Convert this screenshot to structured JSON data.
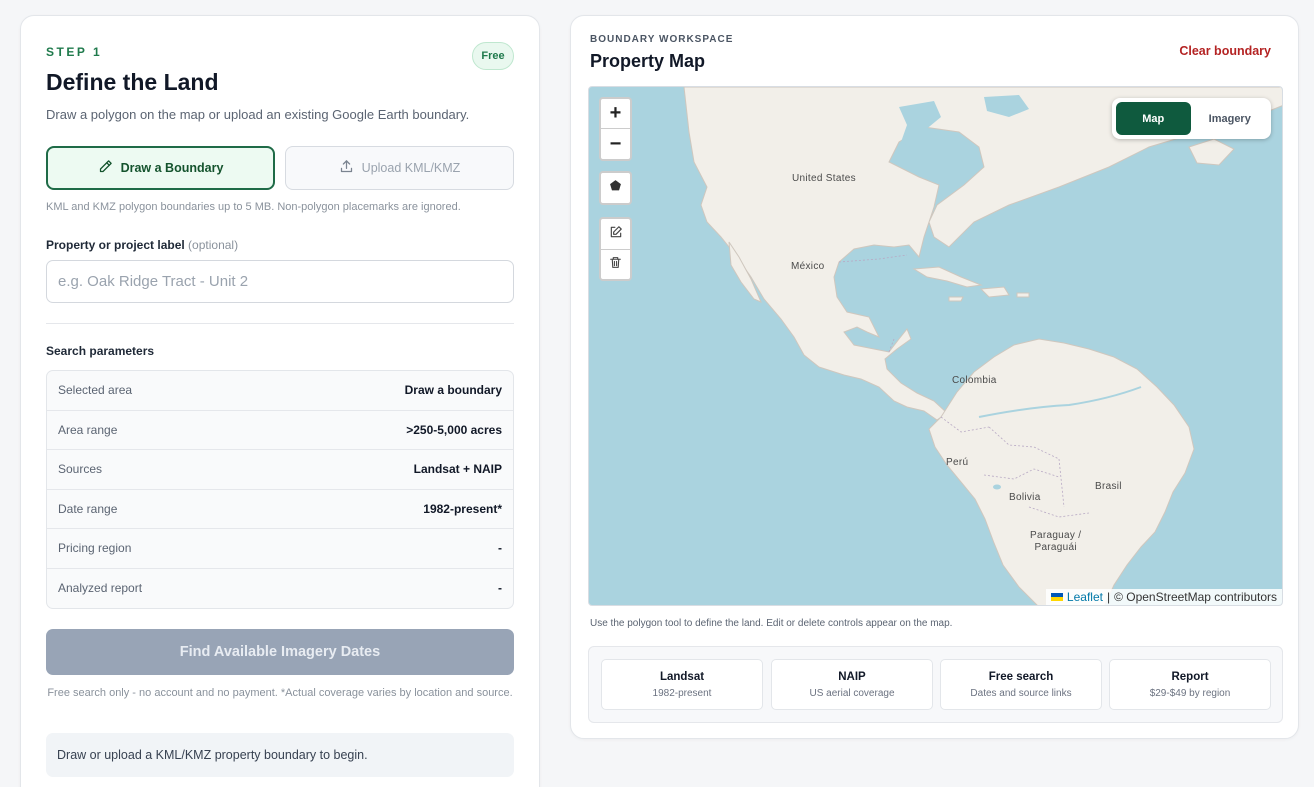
{
  "left": {
    "step": "STEP 1",
    "badge": "Free",
    "title": "Define the Land",
    "subtitle": "Draw a polygon on the map or upload an existing Google Earth boundary.",
    "draw_button": "Draw a Boundary",
    "upload_button": "Upload KML/KMZ",
    "hint": "KML and KMZ polygon boundaries up to 5 MB. Non-polygon placemarks are ignored.",
    "label_title": "Property or project label",
    "label_optional": "(optional)",
    "label_placeholder": "e.g. Oak Ridge Tract - Unit 2",
    "section_title": "Search parameters",
    "params": [
      {
        "key": "Selected area",
        "value": "Draw a boundary"
      },
      {
        "key": "Area range",
        "value": ">250-5,000 acres"
      },
      {
        "key": "Sources",
        "value": "Landsat + NAIP"
      },
      {
        "key": "Date range",
        "value": "1982-present*"
      },
      {
        "key": "Pricing region",
        "value": "-"
      },
      {
        "key": "Analyzed report",
        "value": "-"
      }
    ],
    "find_button": "Find Available Imagery Dates",
    "fine_print": "Free search only - no account and no payment. *Actual coverage varies by location and source.",
    "status": "Draw or upload a KML/KMZ property boundary to begin."
  },
  "right": {
    "workspace_label": "BOUNDARY WORKSPACE",
    "title": "Property Map",
    "clear_button": "Clear boundary",
    "zoom_in": "+",
    "zoom_out": "−",
    "layers": {
      "map": "Map",
      "imagery": "Imagery"
    },
    "map_labels": {
      "us": "United States",
      "mexico": "México",
      "colombia": "Colombia",
      "peru": "Perú",
      "bolivia": "Bolivia",
      "brasil": "Brasil",
      "paraguay_1": "Paraguay /",
      "paraguay_2": "Paraguái"
    },
    "attribution_leaflet": "Leaflet",
    "attribution_sep": "|",
    "attribution_osm": "© OpenStreetMap contributors",
    "map_hint": "Use the polygon tool to define the land. Edit or delete controls appear on the map.",
    "features": [
      {
        "title": "Landsat",
        "sub": "1982-present"
      },
      {
        "title": "NAIP",
        "sub": "US aerial coverage"
      },
      {
        "title": "Free search",
        "sub": "Dates and source links"
      },
      {
        "title": "Report",
        "sub": "$29-$49 by region"
      }
    ]
  },
  "colors": {
    "accent": "#0f5a3e",
    "danger": "#b42323",
    "ocean": "#aad3df",
    "land": "#f2efe9"
  },
  "icons": {
    "draw": "pencil-icon",
    "upload": "upload-icon",
    "polygon": "polygon-icon",
    "edit": "edit-icon",
    "delete": "trash-icon"
  }
}
